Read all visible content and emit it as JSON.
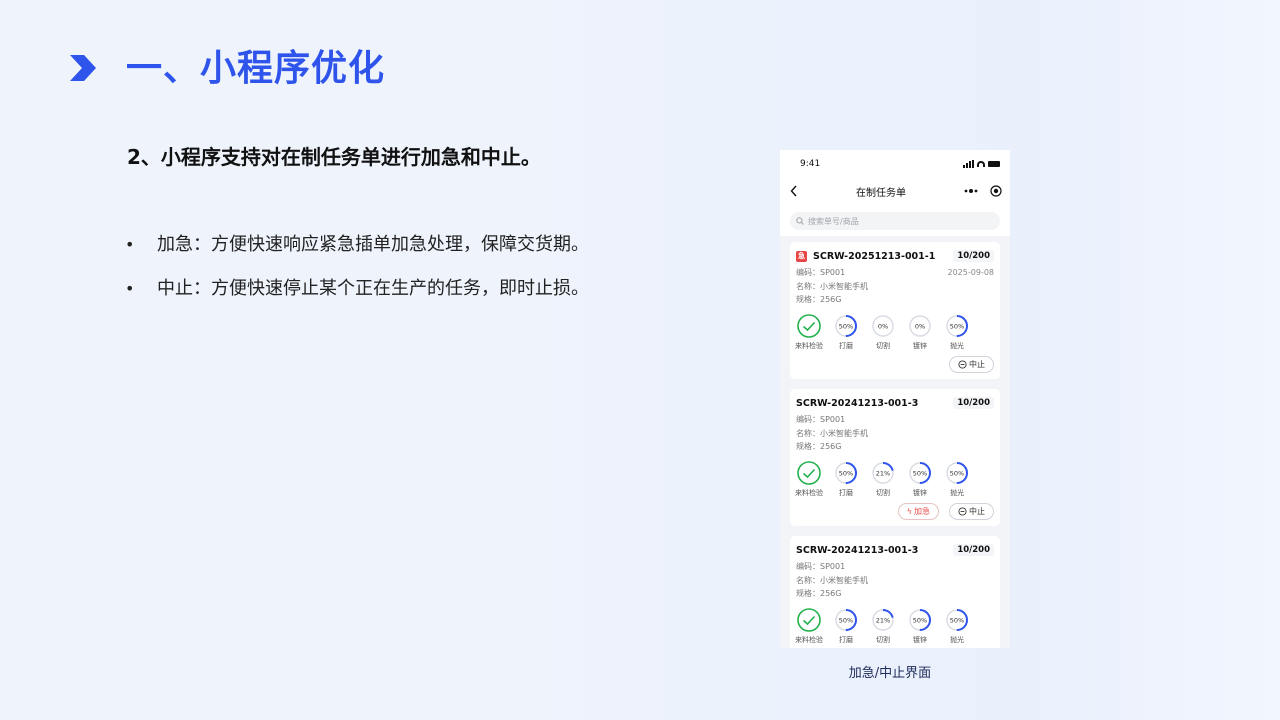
{
  "slide": {
    "title": "一、小程序优化",
    "subtitle": "2、小程序支持对在制任务单进行加急和中止。",
    "bullets": [
      "加急：方便快速响应紧急插单加急处理，保障交货期。",
      "中止：方便快速停止某个正在生产的任务，即时止损。"
    ],
    "caption": "加急/中止界面",
    "accent_color": "#2f54eb"
  },
  "phone": {
    "time": "9:41",
    "nav_title": "在制任务单",
    "more_icon": "dots-icon",
    "search_placeholder": "搜索单号/商品",
    "cards": [
      {
        "urgent_tag": "急",
        "code": "SCRW-20251213-001-1",
        "qty": "10/200",
        "date": "2025-09-08",
        "meta": [
          "编码：SP001",
          "名称：小米智能手机",
          "规格：256G"
        ],
        "steps": [
          {
            "label": "来料检验",
            "done": true,
            "progress": 1
          },
          {
            "label": "打磨",
            "text": "50%",
            "progress": 0.5
          },
          {
            "label": "切割",
            "text": "0%",
            "progress": 0
          },
          {
            "label": "镀锌",
            "text": "0%",
            "progress": 0
          },
          {
            "label": "抛光",
            "text": "50%",
            "progress": 0.5
          }
        ],
        "actions": {
          "stop": "中止"
        }
      },
      {
        "code": "SCRW-20241213-001-3",
        "qty": "10/200",
        "meta": [
          "编码：SP001",
          "名称：小米智能手机",
          "规格：256G"
        ],
        "steps": [
          {
            "label": "来料检验",
            "done": true,
            "progress": 1
          },
          {
            "label": "打磨",
            "text": "50%",
            "progress": 0.5
          },
          {
            "label": "切割",
            "text": "21%",
            "progress": 0.21
          },
          {
            "label": "镀锌",
            "text": "50%",
            "progress": 0.5
          },
          {
            "label": "抛光",
            "text": "50%",
            "progress": 0.5
          }
        ],
        "actions": {
          "urgent": "加急",
          "stop": "中止"
        }
      },
      {
        "code": "SCRW-20241213-001-3",
        "qty": "10/200",
        "meta": [
          "编码：SP001",
          "名称：小米智能手机",
          "规格：256G"
        ],
        "steps": [
          {
            "label": "来料检验",
            "done": true,
            "progress": 1
          },
          {
            "label": "打磨",
            "text": "50%",
            "progress": 0.5
          },
          {
            "label": "切割",
            "text": "21%",
            "progress": 0.21
          },
          {
            "label": "镀锌",
            "text": "50%",
            "progress": 0.5
          },
          {
            "label": "抛光",
            "text": "50%",
            "progress": 0.5
          }
        ]
      }
    ]
  }
}
